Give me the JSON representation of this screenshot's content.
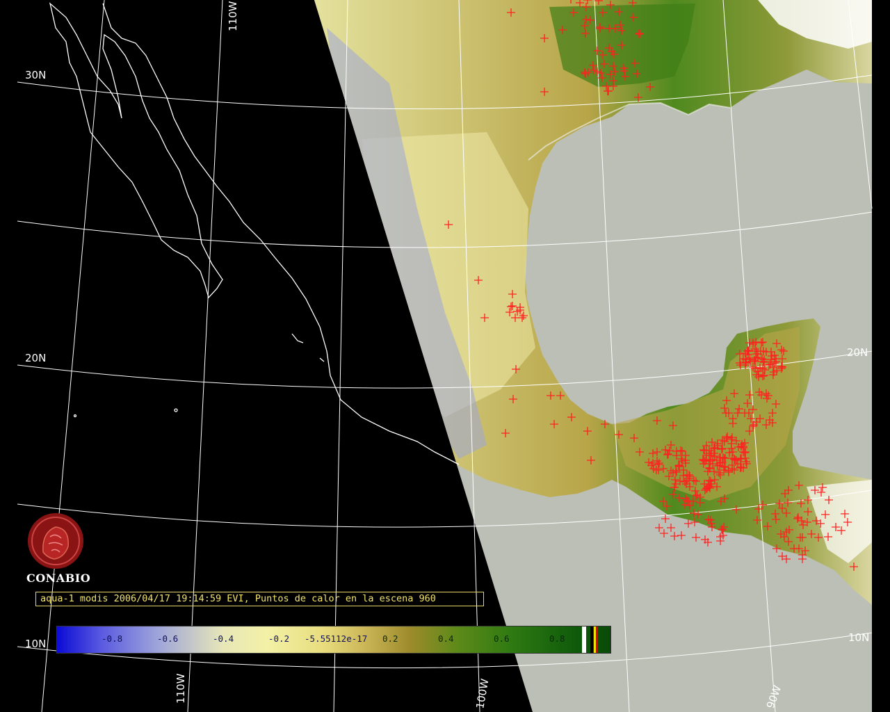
{
  "caption": "aqua-1 modis 2006/04/17 19:14:59 EVI, Puntos de calor en la escena 960",
  "logo_text": "CONABIO",
  "gridlines": {
    "lat_labels": [
      "30N",
      "20N",
      "10N",
      "20N",
      "10N"
    ],
    "lon_labels": [
      "110W",
      "110W",
      "100W",
      "90W"
    ]
  },
  "colorbar": {
    "ticks": [
      "-0.8",
      "-0.6",
      "-0.4",
      "-0.2",
      "-5.55112e-17",
      "0.2",
      "0.4",
      "0.6",
      "0.8"
    ],
    "colors": [
      "#0b0bd6",
      "#9da3da",
      "#f3f1a6",
      "#c9b455",
      "#2f7a12",
      "#0a4a08"
    ]
  },
  "colors": {
    "hotspot": "#ff2020",
    "ocean": "#bcbfb6",
    "night": "#000000",
    "caption": "#f2e46a"
  }
}
